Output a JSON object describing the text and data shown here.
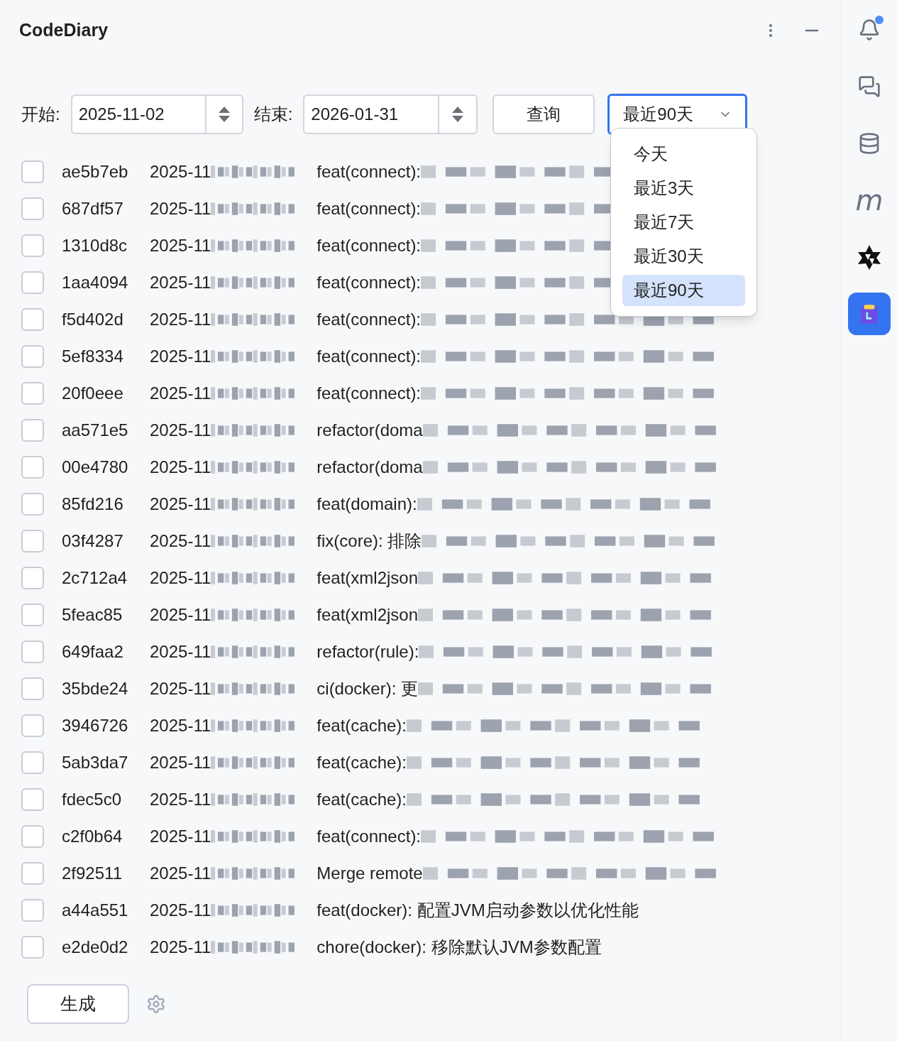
{
  "panel": {
    "title": "CodeDiary"
  },
  "filter": {
    "start_label": "开始:",
    "start": "2025-11-02",
    "end_label": "结束:",
    "end": "2026-01-31",
    "query_button": "查询",
    "range": {
      "value": "最近90天",
      "expanded": true,
      "options": [
        {
          "label": "今天",
          "selected": false
        },
        {
          "label": "最近3天",
          "selected": false
        },
        {
          "label": "最近7天",
          "selected": false
        },
        {
          "label": "最近30天",
          "selected": false
        },
        {
          "label": "最近90天",
          "selected": true
        }
      ]
    }
  },
  "commits": [
    {
      "hash": "ae5b7eb",
      "date": "2025-11",
      "message": "feat(connect):",
      "redacted": true,
      "checked": false
    },
    {
      "hash": "687df57",
      "date": "2025-11",
      "message": "feat(connect):",
      "redacted": true,
      "checked": false
    },
    {
      "hash": "1310d8c",
      "date": "2025-11",
      "message": "feat(connect):",
      "redacted": true,
      "checked": false
    },
    {
      "hash": "1aa4094",
      "date": "2025-11",
      "message": "feat(connect):",
      "redacted": true,
      "checked": false
    },
    {
      "hash": "f5d402d",
      "date": "2025-11",
      "message": "feat(connect):",
      "redacted": true,
      "checked": false
    },
    {
      "hash": "5ef8334",
      "date": "2025-11",
      "message": "feat(connect):",
      "redacted": true,
      "checked": false
    },
    {
      "hash": "20f0eee",
      "date": "2025-11",
      "message": "feat(connect):",
      "redacted": true,
      "checked": false
    },
    {
      "hash": "aa571e5",
      "date": "2025-11",
      "message": "refactor(doma",
      "redacted": true,
      "checked": false
    },
    {
      "hash": "00e4780",
      "date": "2025-11",
      "message": "refactor(doma",
      "redacted": true,
      "checked": false
    },
    {
      "hash": "85fd216",
      "date": "2025-11",
      "message": "feat(domain):",
      "redacted": true,
      "checked": false
    },
    {
      "hash": "03f4287",
      "date": "2025-11",
      "message": "fix(core): 排除",
      "redacted": true,
      "checked": false
    },
    {
      "hash": "2c712a4",
      "date": "2025-11",
      "message": "feat(xml2json",
      "redacted": true,
      "checked": false
    },
    {
      "hash": "5feac85",
      "date": "2025-11",
      "message": "feat(xml2json",
      "redacted": true,
      "checked": false
    },
    {
      "hash": "649faa2",
      "date": "2025-11",
      "message": "refactor(rule):",
      "redacted": true,
      "checked": false
    },
    {
      "hash": "35bde24",
      "date": "2025-11",
      "message": "ci(docker): 更",
      "redacted": true,
      "checked": false
    },
    {
      "hash": "3946726",
      "date": "2025-11",
      "message": "feat(cache):",
      "redacted": true,
      "checked": false
    },
    {
      "hash": "5ab3da7",
      "date": "2025-11",
      "message": "feat(cache):",
      "redacted": true,
      "checked": false
    },
    {
      "hash": "fdec5c0",
      "date": "2025-11",
      "message": "feat(cache):",
      "redacted": true,
      "checked": false
    },
    {
      "hash": "c2f0b64",
      "date": "2025-11",
      "message": "feat(connect):",
      "redacted": true,
      "checked": false
    },
    {
      "hash": "2f92511",
      "date": "2025-11",
      "message": "Merge remote",
      "redacted": true,
      "checked": false
    },
    {
      "hash": "a44a551",
      "date": "2025-11",
      "message": "feat(docker): 配置JVM启动参数以优化性能",
      "redacted": false,
      "checked": false
    },
    {
      "hash": "e2de0d2",
      "date": "2025-11",
      "message": "chore(docker): 移除默认JVM参数配置",
      "redacted": false,
      "checked": false
    }
  ],
  "generate_button": "生成",
  "sidebar": [
    {
      "kind": "bell",
      "badge": true,
      "selected": false
    },
    {
      "kind": "chat",
      "selected": false
    },
    {
      "kind": "database",
      "selected": false
    },
    {
      "kind": "letter",
      "text": "m",
      "selected": false
    },
    {
      "kind": "star",
      "selected": false
    },
    {
      "kind": "calendar",
      "selected": true
    }
  ]
}
